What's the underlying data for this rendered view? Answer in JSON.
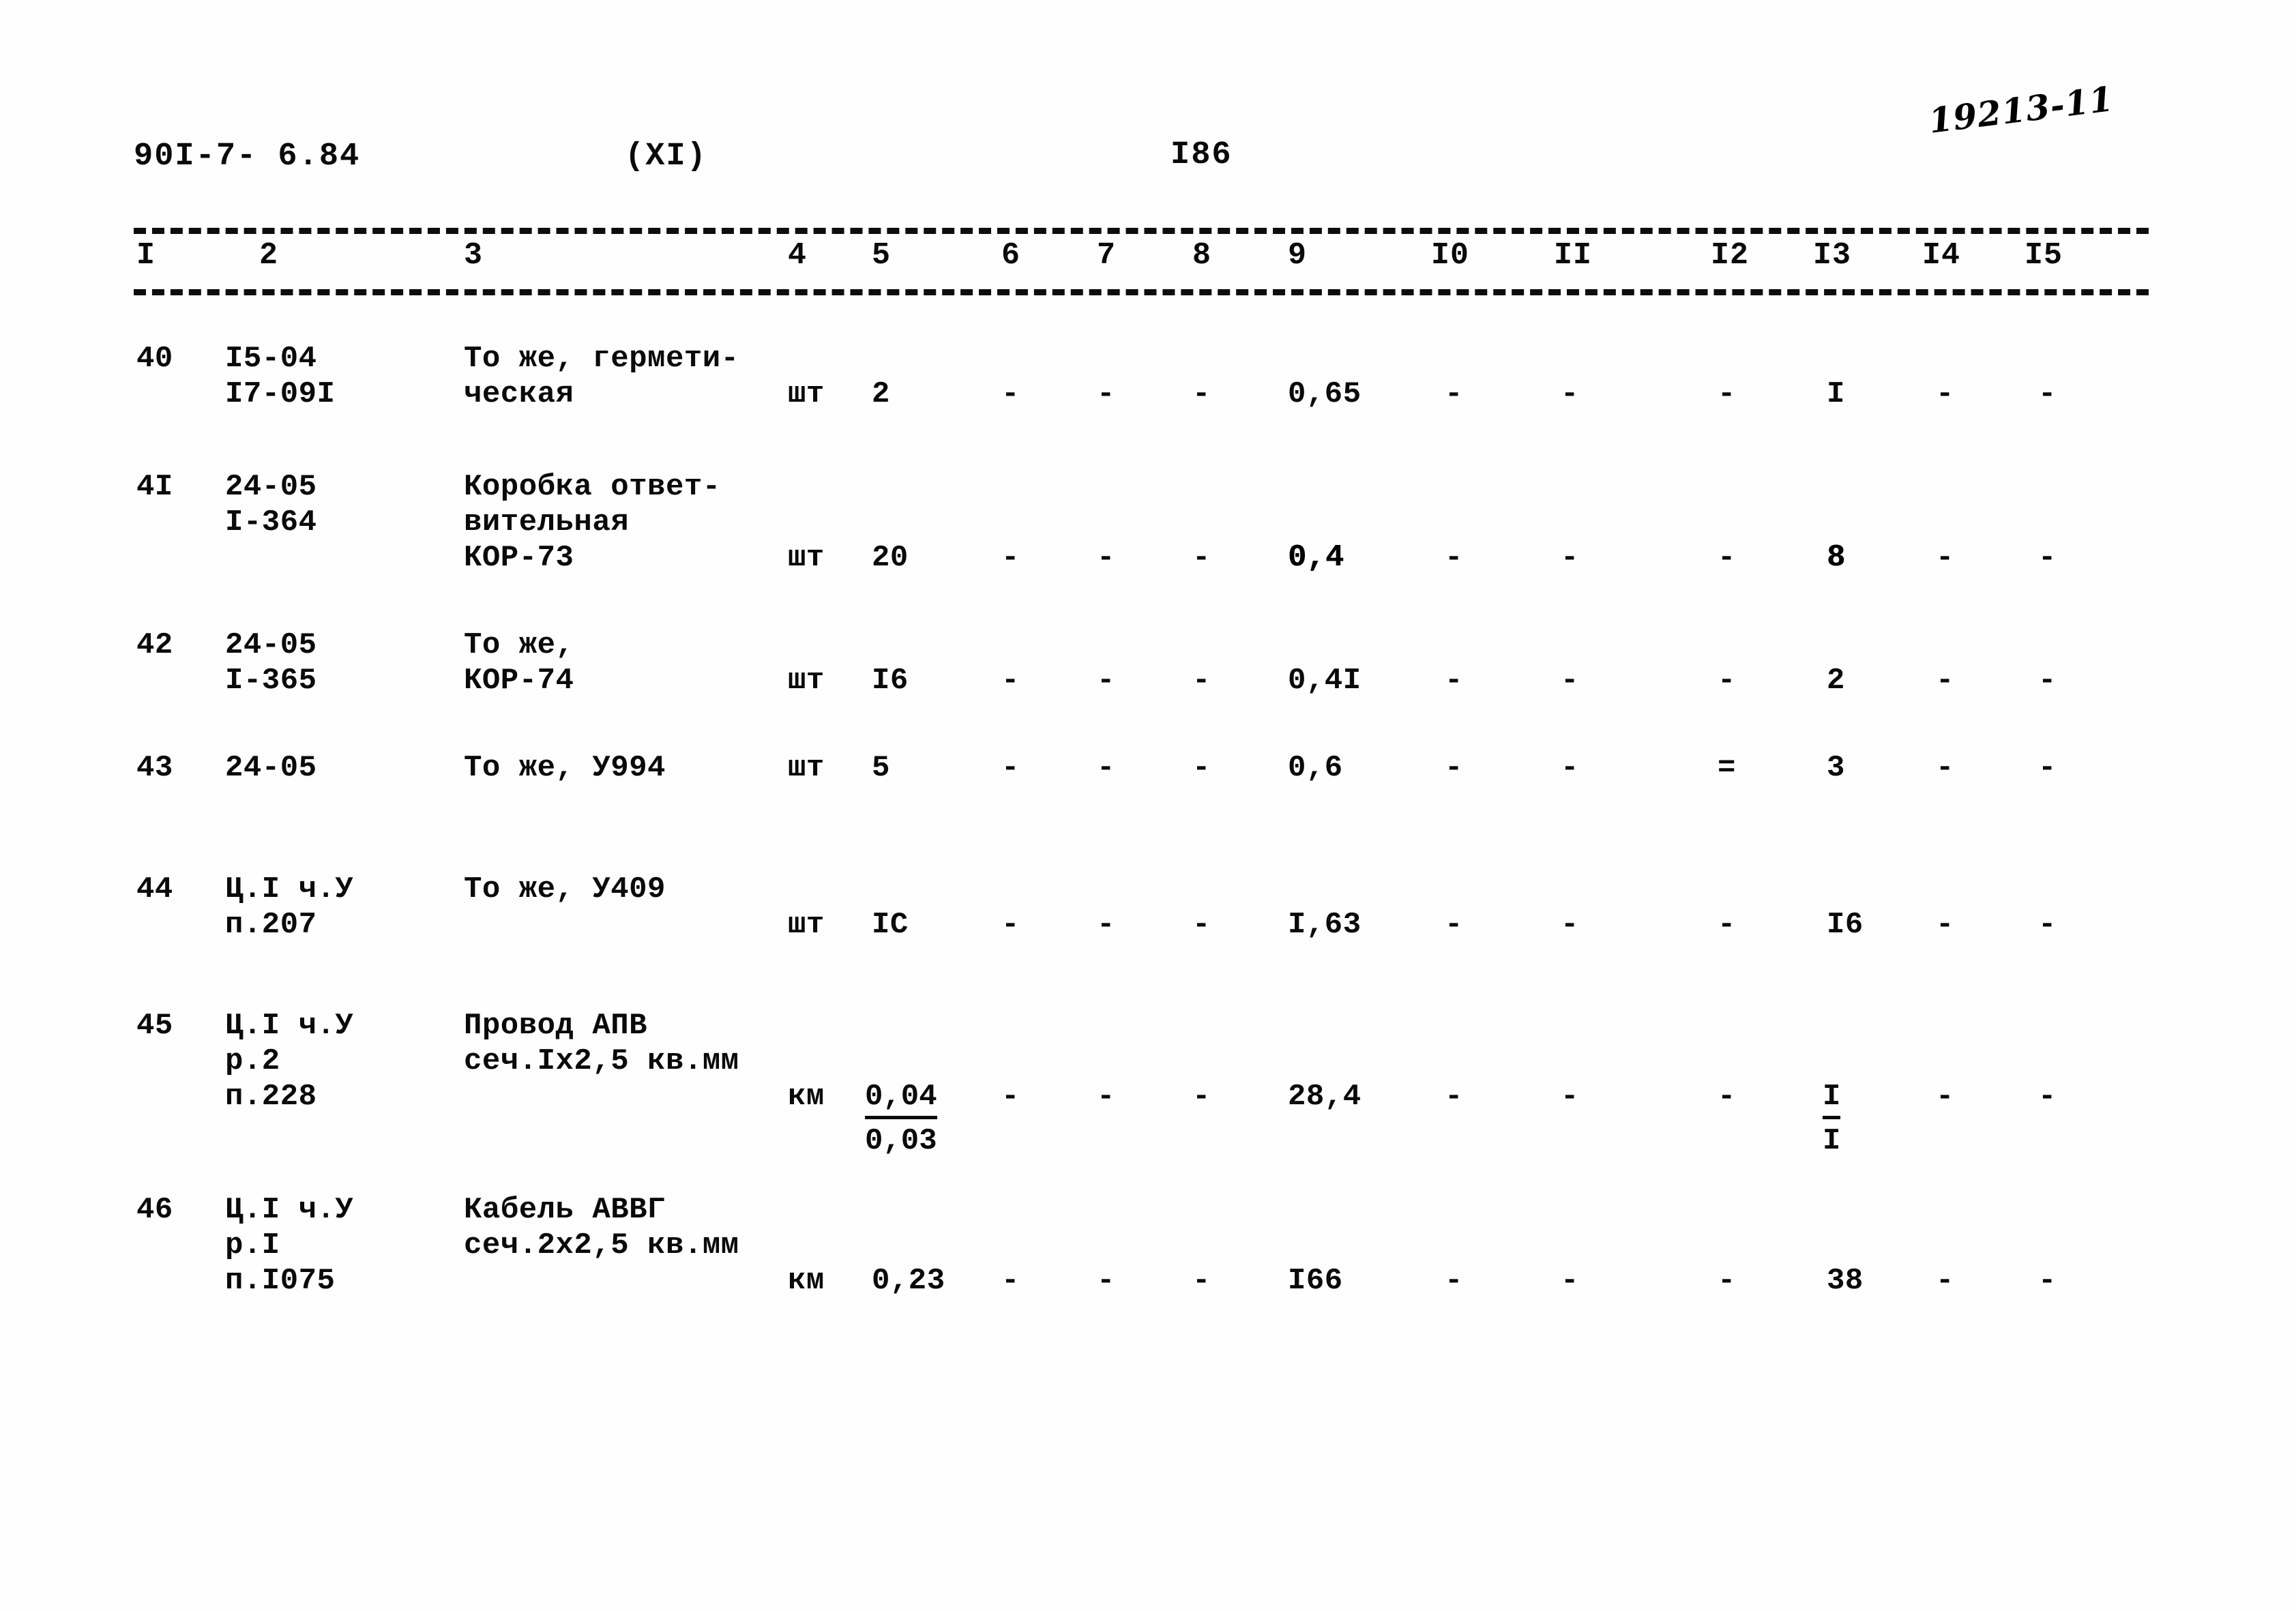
{
  "header": {
    "doc_code": "90I-7- 6.84",
    "section": "(XI)",
    "page_number": "I86",
    "handwritten_note": "19213-11"
  },
  "table": {
    "column_numbers": [
      "I",
      "2",
      "3",
      "4",
      "5",
      "6",
      "7",
      "8",
      "9",
      "I0",
      "II",
      "I2",
      "I3",
      "I4",
      "I5"
    ],
    "dash_symbol": "-",
    "double_dash_symbol": "=",
    "rows": [
      {
        "num": "40",
        "code": "I5-04\nI7-09I",
        "name": "То же, гермети-\nческая",
        "unit": "шт",
        "qty": "2",
        "col6": "-",
        "col7": "-",
        "col8": "-",
        "col9": "0,65",
        "col10": "-",
        "col11": "-",
        "col12": "-",
        "col13": "I",
        "col14": "-",
        "col15": "-"
      },
      {
        "num": "4I",
        "code": "24-05\nI-364",
        "name": "Коробка ответ-\nвительная\nКОР-73",
        "unit": "шт",
        "qty": "20",
        "col6": "-",
        "col7": "-",
        "col8": "-",
        "col9": "0,4",
        "col10": "-",
        "col11": "-",
        "col12": "-",
        "col13": "8",
        "col14": "-",
        "col15": "-"
      },
      {
        "num": "42",
        "code": "24-05\nI-365",
        "name": "То же,\nКОР-74",
        "unit": "шт",
        "qty": "I6",
        "col6": "-",
        "col7": "-",
        "col8": "-",
        "col9": "0,4I",
        "col10": "-",
        "col11": "-",
        "col12": "-",
        "col13": "2",
        "col14": "-",
        "col15": "-"
      },
      {
        "num": "43",
        "code": "24-05",
        "name": "То же, У994",
        "unit": "шт",
        "qty": "5",
        "col6": "-",
        "col7": "-",
        "col8": "-",
        "col9": "0,6",
        "col10": "-",
        "col11": "-",
        "col12": "=",
        "col13": "3",
        "col14": "-",
        "col15": "-"
      },
      {
        "num": "44",
        "code": "Ц.I ч.У\nп.207",
        "name": "То же, У409",
        "unit": "шт",
        "qty": "IC",
        "col6": "-",
        "col7": "-",
        "col8": "-",
        "col9": "I,63",
        "col10": "-",
        "col11": "-",
        "col12": "-",
        "col13": "I6",
        "col14": "-",
        "col15": "-"
      },
      {
        "num": "45",
        "code": "Ц.I ч.У\nр.2\nп.228",
        "name": "Провод АПВ\nсеч.Iх2,5 кв.мм",
        "unit": "км",
        "qty_numerator": "0,04",
        "qty_denominator": "0,03",
        "col6": "-",
        "col7": "-",
        "col8": "-",
        "col9": "28,4",
        "col10": "-",
        "col11": "-",
        "col12": "-",
        "col13_numerator": "I",
        "col13_denominator": "I",
        "col14": "-",
        "col15": "-"
      },
      {
        "num": "46",
        "code": "Ц.I ч.У\nр.I\nп.I075",
        "name": "Кабель АВВГ\nсеч.2х2,5 кв.мм",
        "unit": "км",
        "qty": "0,23",
        "col6": "-",
        "col7": "-",
        "col8": "-",
        "col9": "I66",
        "col10": "-",
        "col11": "-",
        "col12": "-",
        "col13": "38",
        "col14": "-",
        "col15": "-"
      }
    ]
  }
}
